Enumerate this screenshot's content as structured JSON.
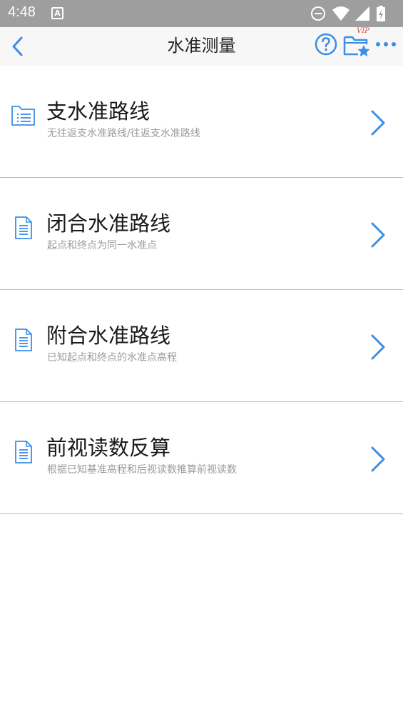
{
  "status_bar": {
    "time": "4:48",
    "notification_icon_letter": "A",
    "icons": [
      "dnd-icon",
      "wifi-icon",
      "signal-icon",
      "battery-icon"
    ]
  },
  "app_bar": {
    "title": "水准测量",
    "vip_label": "VIP",
    "icons": [
      "back-icon",
      "help-icon",
      "vip-folder-icon",
      "more-icon"
    ]
  },
  "colors": {
    "accent": "#3a8ee6",
    "status_bar_bg": "#9e9e9e",
    "app_bar_bg": "#f7f7f7",
    "divider": "#bdbdbd",
    "subtitle_text": "#9a9a9a",
    "vip_red": "#d9534f"
  },
  "menu": {
    "items": [
      {
        "title": "支水准路线",
        "subtitle": "无往返支水准路线/往返支水准路线",
        "icon": "folder-list-icon"
      },
      {
        "title": "闭合水准路线",
        "subtitle": "起点和终点为同一水准点",
        "icon": "document-icon"
      },
      {
        "title": "附合水准路线",
        "subtitle": "已知起点和终点的水准点高程",
        "icon": "document-icon"
      },
      {
        "title": "前视读数反算",
        "subtitle": "根据已知基准高程和后视读数推算前视读数",
        "icon": "document-icon"
      }
    ]
  }
}
